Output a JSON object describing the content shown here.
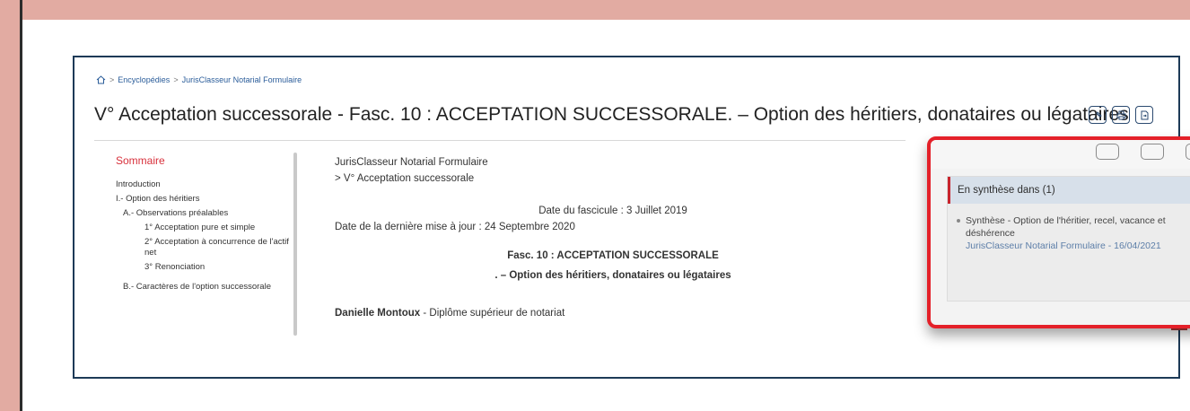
{
  "breadcrumb": {
    "items": [
      "Encyclopédies",
      "JurisClasseur Notarial Formulaire"
    ],
    "separator": ">"
  },
  "title": "V° Acceptation successorale - Fasc. 10 : ACCEPTATION SUCCESSORALE. – Option des héritiers, donataires ou légataires",
  "toc": {
    "title": "Sommaire",
    "items": [
      {
        "label": "Introduction",
        "level": 1
      },
      {
        "label": "I.- Option des héritiers",
        "level": 1
      },
      {
        "label": "A.- Observations préalables",
        "level": 2
      },
      {
        "label": "1° Acceptation pure et simple",
        "level": 3
      },
      {
        "label": "2° Acceptation à concurrence de l'actif net",
        "level": 3
      },
      {
        "label": "3° Renonciation",
        "level": 3
      },
      {
        "label": "B.- Caractères de l'option successorale",
        "level": 2
      }
    ]
  },
  "content": {
    "source": "JurisClasseur Notarial Formulaire",
    "subsource": "> V° Acceptation successorale",
    "date_fascicule": "Date du fascicule : 3 Juillet 2019",
    "date_maj": "Date de la dernière mise à jour : 24 Septembre 2020",
    "fasc_label": "Fasc. 10 : ACCEPTATION SUCCESSORALE",
    "fasc_subtitle": ". – Option des héritiers, donataires ou légataires",
    "author_name": "Danielle Montoux",
    "author_title": " - Diplôme supérieur de notariat"
  },
  "synthese": {
    "header": "En synthèse dans (1)",
    "item_title": "Synthèse - Option de l'héritier, recel, vacance et déshérence",
    "item_source": "JurisClasseur Notarial Formulaire - 16/04/2021"
  },
  "icons": [
    "home-icon",
    "pin-icon",
    "print-icon",
    "export-icon"
  ],
  "colors": {
    "accent_red": "#d8303b",
    "callout_border": "#e42029",
    "frame_border": "#1d3a57",
    "link_blue": "#2b5d9a",
    "outer_background": "#e2aba2"
  }
}
